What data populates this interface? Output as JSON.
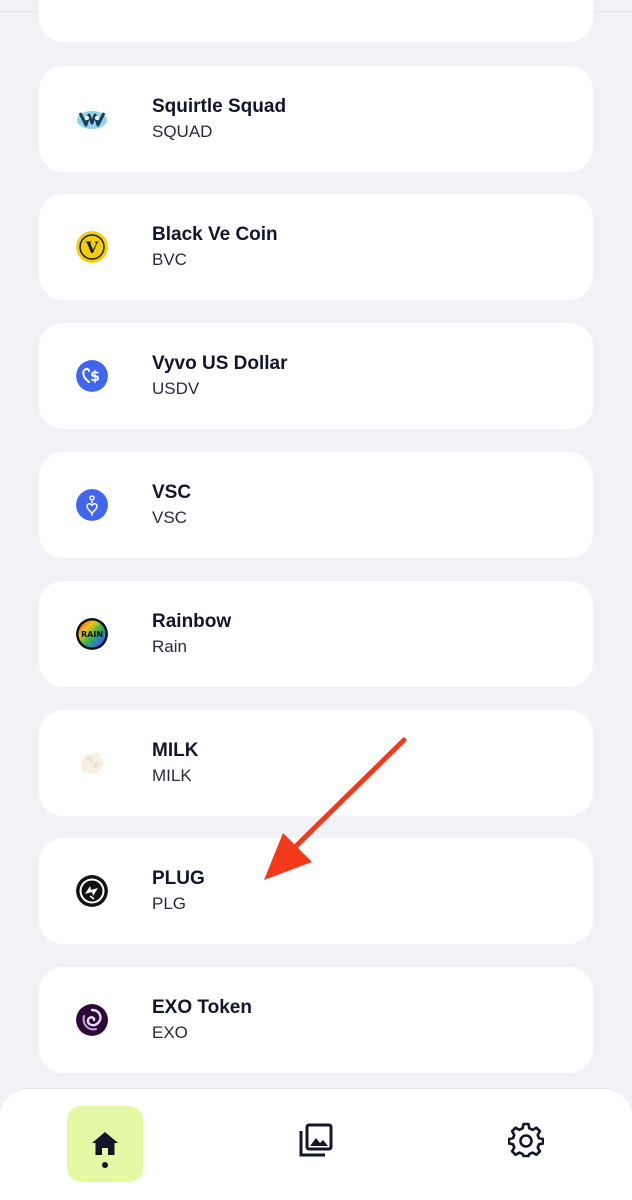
{
  "tokens": [
    {
      "name": "Squirtle Squad",
      "symbol": "SQUAD",
      "icon": "squirtle-squad-icon"
    },
    {
      "name": "Black Ve Coin",
      "symbol": "BVC",
      "icon": "black-ve-coin-icon"
    },
    {
      "name": "Vyvo US Dollar",
      "symbol": "USDV",
      "icon": "vyvo-us-dollar-icon"
    },
    {
      "name": "VSC",
      "symbol": "VSC",
      "icon": "vsc-icon"
    },
    {
      "name": "Rainbow",
      "symbol": "Rain",
      "icon": "rainbow-icon",
      "icon_text": "RAIN"
    },
    {
      "name": "MILK",
      "symbol": "MILK",
      "icon": "milk-icon"
    },
    {
      "name": "PLUG",
      "symbol": "PLG",
      "icon": "plug-icon"
    },
    {
      "name": "EXO Token",
      "symbol": "EXO",
      "icon": "exo-token-icon"
    }
  ],
  "icon_glyphs": {
    "black_ve_coin": "V",
    "vyvo_dollar": "$"
  },
  "nav": {
    "items": [
      {
        "icon": "home-icon",
        "active": true
      },
      {
        "icon": "gallery-icon",
        "active": false
      },
      {
        "icon": "gear-icon",
        "active": false
      }
    ]
  },
  "colors": {
    "background": "#f2f2f6",
    "card": "#ffffff",
    "text_primary": "#14142b",
    "nav_active": "#e4f9a4",
    "annotation_arrow": "#f2391a"
  }
}
